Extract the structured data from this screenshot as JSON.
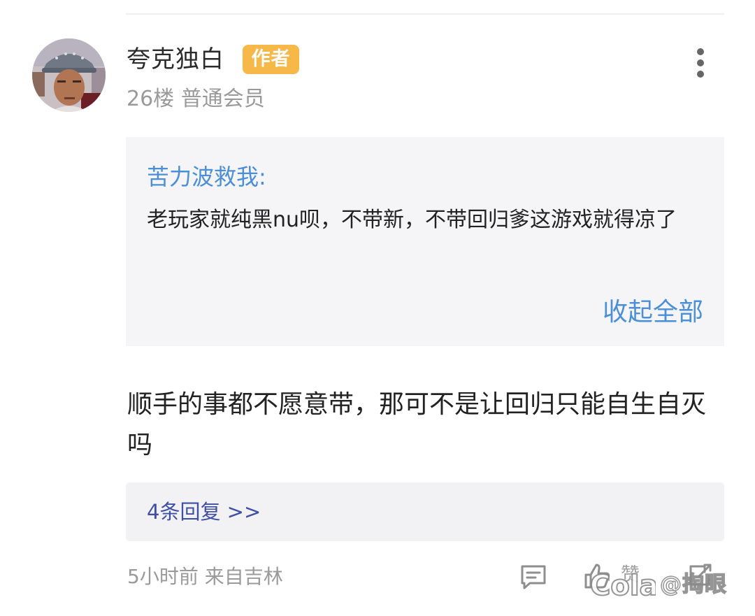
{
  "user": {
    "name": "夸克独白",
    "badge": "作者",
    "meta": "26楼 普通会员",
    "avatar_icon": "avatar-photo"
  },
  "quote": {
    "author": "苦力波救我:",
    "text": "老玩家就纯黑nu呗，不带新，不带回归爹这游戏就得凉了",
    "collapse_label": "收起全部"
  },
  "comment": {
    "text": "顺手的事都不愿意带，那可不是让回归只能自生自灭吗"
  },
  "replies": {
    "label": "4条回复 >>"
  },
  "footer": {
    "meta": "5小时前 来自吉林",
    "like_label": "赞"
  },
  "icons": {
    "more": "more-vertical-icon",
    "comment": "comment-icon",
    "like": "thumbs-up-icon",
    "share": "share-icon"
  },
  "colors": {
    "badge": "#f7b84a",
    "link": "#4a8fd8",
    "replies_link": "#3f4fa3",
    "meta_text": "#9a9a9a"
  },
  "watermark": {
    "logo_text": "Cola",
    "handle": "@掏眼"
  }
}
